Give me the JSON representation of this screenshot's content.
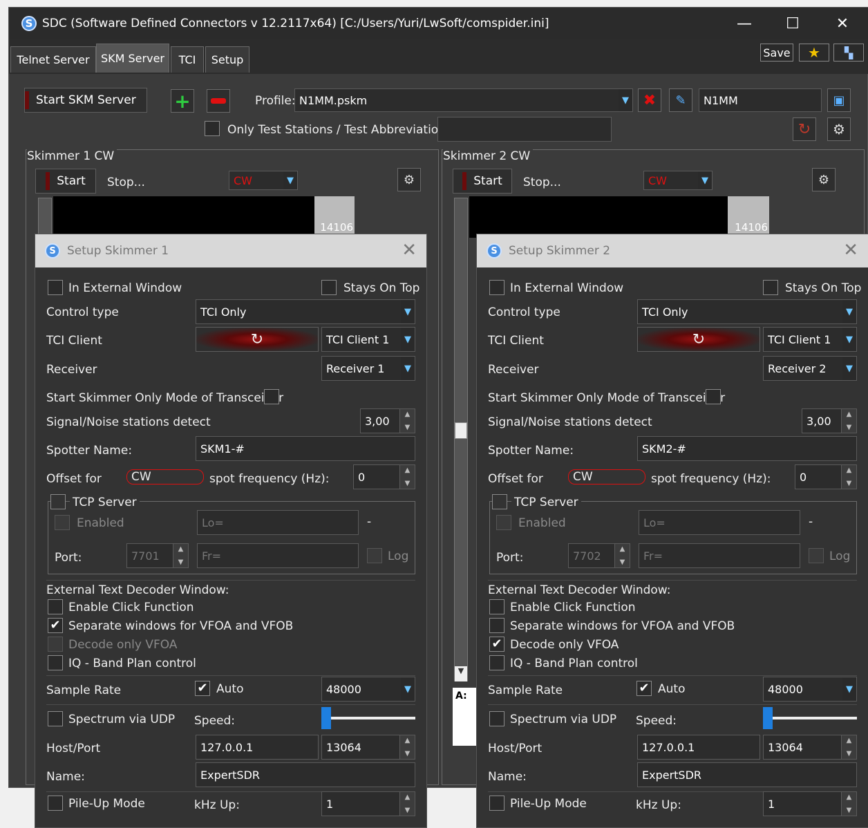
{
  "window": {
    "title": "SDC (Software Defined Connectors v 12.2117x64) [C:/Users/Yuri/LwSoft/comspider.ini]",
    "minimize_icon": "minimize-icon",
    "maximize_icon": "maximize-icon",
    "close_icon": "close-icon"
  },
  "tabs": [
    {
      "label": "Telnet Server"
    },
    {
      "label": "SKM Server"
    },
    {
      "label": "TCI"
    },
    {
      "label": "Setup"
    }
  ],
  "toolbar": {
    "save_label": "Save",
    "start_server_label": "Start SKM Server",
    "profile_label": "Profile:",
    "profile_value": "N1MM.pskm",
    "profile_name_value": "N1MM",
    "only_test_label": "Only Test Stations / Test Abbreviation:",
    "test_abbreviation_value": ""
  },
  "skimmers": [
    {
      "group_label": "Skimmer 1 CW",
      "start_label": "Start",
      "stop_label": "Stop...",
      "mode_value": "CW",
      "scale_value": "14106"
    },
    {
      "group_label": "Skimmer 2 CW",
      "start_label": "Start",
      "stop_label": "Stop...",
      "mode_value": "CW",
      "scale_value": "14106"
    }
  ],
  "fragment_text": "A:",
  "dialogs": [
    {
      "title": "Setup Skimmer 1",
      "in_external_window": "In External Window",
      "in_external_window_checked": false,
      "stays_on_top": "Stays On Top",
      "stays_on_top_checked": false,
      "control_type_label": "Control type",
      "control_type_value": "TCI Only",
      "tci_client_label": "TCI Client",
      "tci_client_value": "TCI Client 1",
      "receiver_label": "Receiver",
      "receiver_value": "Receiver 1",
      "skimmer_only_label": "Start Skimmer Only Mode of Transceiver",
      "snr_label": "Signal/Noise stations detect",
      "snr_value": "3,00",
      "spotter_label": "Spotter Name:",
      "spotter_value": "SKM1-#",
      "offset_label": "Offset for",
      "offset_mode": "CW",
      "spot_freq_label": "spot frequency (Hz):",
      "offset_value": "0",
      "tcp_server_label": "TCP Server",
      "enabled_label": "Enabled",
      "lo_placeholder": "Lo=",
      "dash": "-",
      "port_label": "Port:",
      "port_value": "7701",
      "fr_placeholder": "Fr=",
      "log_label": "Log",
      "ext_decoder_label": "External Text Decoder Window:",
      "enable_click_label": "Enable Click Function",
      "enable_click_checked": false,
      "separate_windows_label": "Separate windows for VFOA and VFOB",
      "separate_windows_checked": true,
      "decode_vfoa_label": "Decode only VFOA",
      "decode_vfoa_checked": false,
      "decode_vfoa_disabled": true,
      "iq_band_label": "IQ - Band Plan control",
      "sample_rate_label": "Sample Rate",
      "auto_label": "Auto",
      "sample_rate_value": "48000",
      "spectrum_udp_label": "Spectrum via UDP",
      "speed_label": "Speed:",
      "host_port_label": "Host/Port",
      "host_value": "127.0.0.1",
      "port2_value": "13064",
      "name_label": "Name:",
      "name_value": "ExpertSDR",
      "pileup_label": "Pile-Up Mode",
      "khz_up_label": "kHz Up:",
      "khz_up_value": "1"
    },
    {
      "title": "Setup Skimmer 2",
      "in_external_window": "In External Window",
      "in_external_window_checked": false,
      "stays_on_top": "Stays On Top",
      "stays_on_top_checked": false,
      "control_type_label": "Control type",
      "control_type_value": "TCI Only",
      "tci_client_label": "TCI Client",
      "tci_client_value": "TCI Client 1",
      "receiver_label": "Receiver",
      "receiver_value": "Receiver 2",
      "skimmer_only_label": "Start Skimmer Only Mode of Transceiver",
      "snr_label": "Signal/Noise stations detect",
      "snr_value": "3,00",
      "spotter_label": "Spotter Name:",
      "spotter_value": "SKM2-#",
      "offset_label": "Offset for",
      "offset_mode": "CW",
      "spot_freq_label": "spot frequency (Hz):",
      "offset_value": "0",
      "tcp_server_label": "TCP Server",
      "enabled_label": "Enabled",
      "lo_placeholder": "Lo=",
      "dash": "-",
      "port_label": "Port:",
      "port_value": "7702",
      "fr_placeholder": "Fr=",
      "log_label": "Log",
      "ext_decoder_label": "External Text Decoder Window:",
      "enable_click_label": "Enable Click Function",
      "enable_click_checked": false,
      "separate_windows_label": "Separate windows for VFOA and VFOB",
      "separate_windows_checked": false,
      "decode_vfoa_label": "Decode only VFOA",
      "decode_vfoa_checked": true,
      "decode_vfoa_disabled": false,
      "iq_band_label": "IQ - Band Plan control",
      "sample_rate_label": "Sample Rate",
      "auto_label": "Auto",
      "sample_rate_value": "48000",
      "spectrum_udp_label": "Spectrum via UDP",
      "speed_label": "Speed:",
      "host_port_label": "Host/Port",
      "host_value": "127.0.0.1",
      "port2_value": "13064",
      "name_label": "Name:",
      "name_value": "ExpertSDR",
      "pileup_label": "Pile-Up Mode",
      "khz_up_label": "kHz Up:",
      "khz_up_value": "1"
    }
  ],
  "colors": {
    "accent": "#1e7fe0",
    "danger": "#d11111",
    "window_bg": "#3b3b3b"
  }
}
